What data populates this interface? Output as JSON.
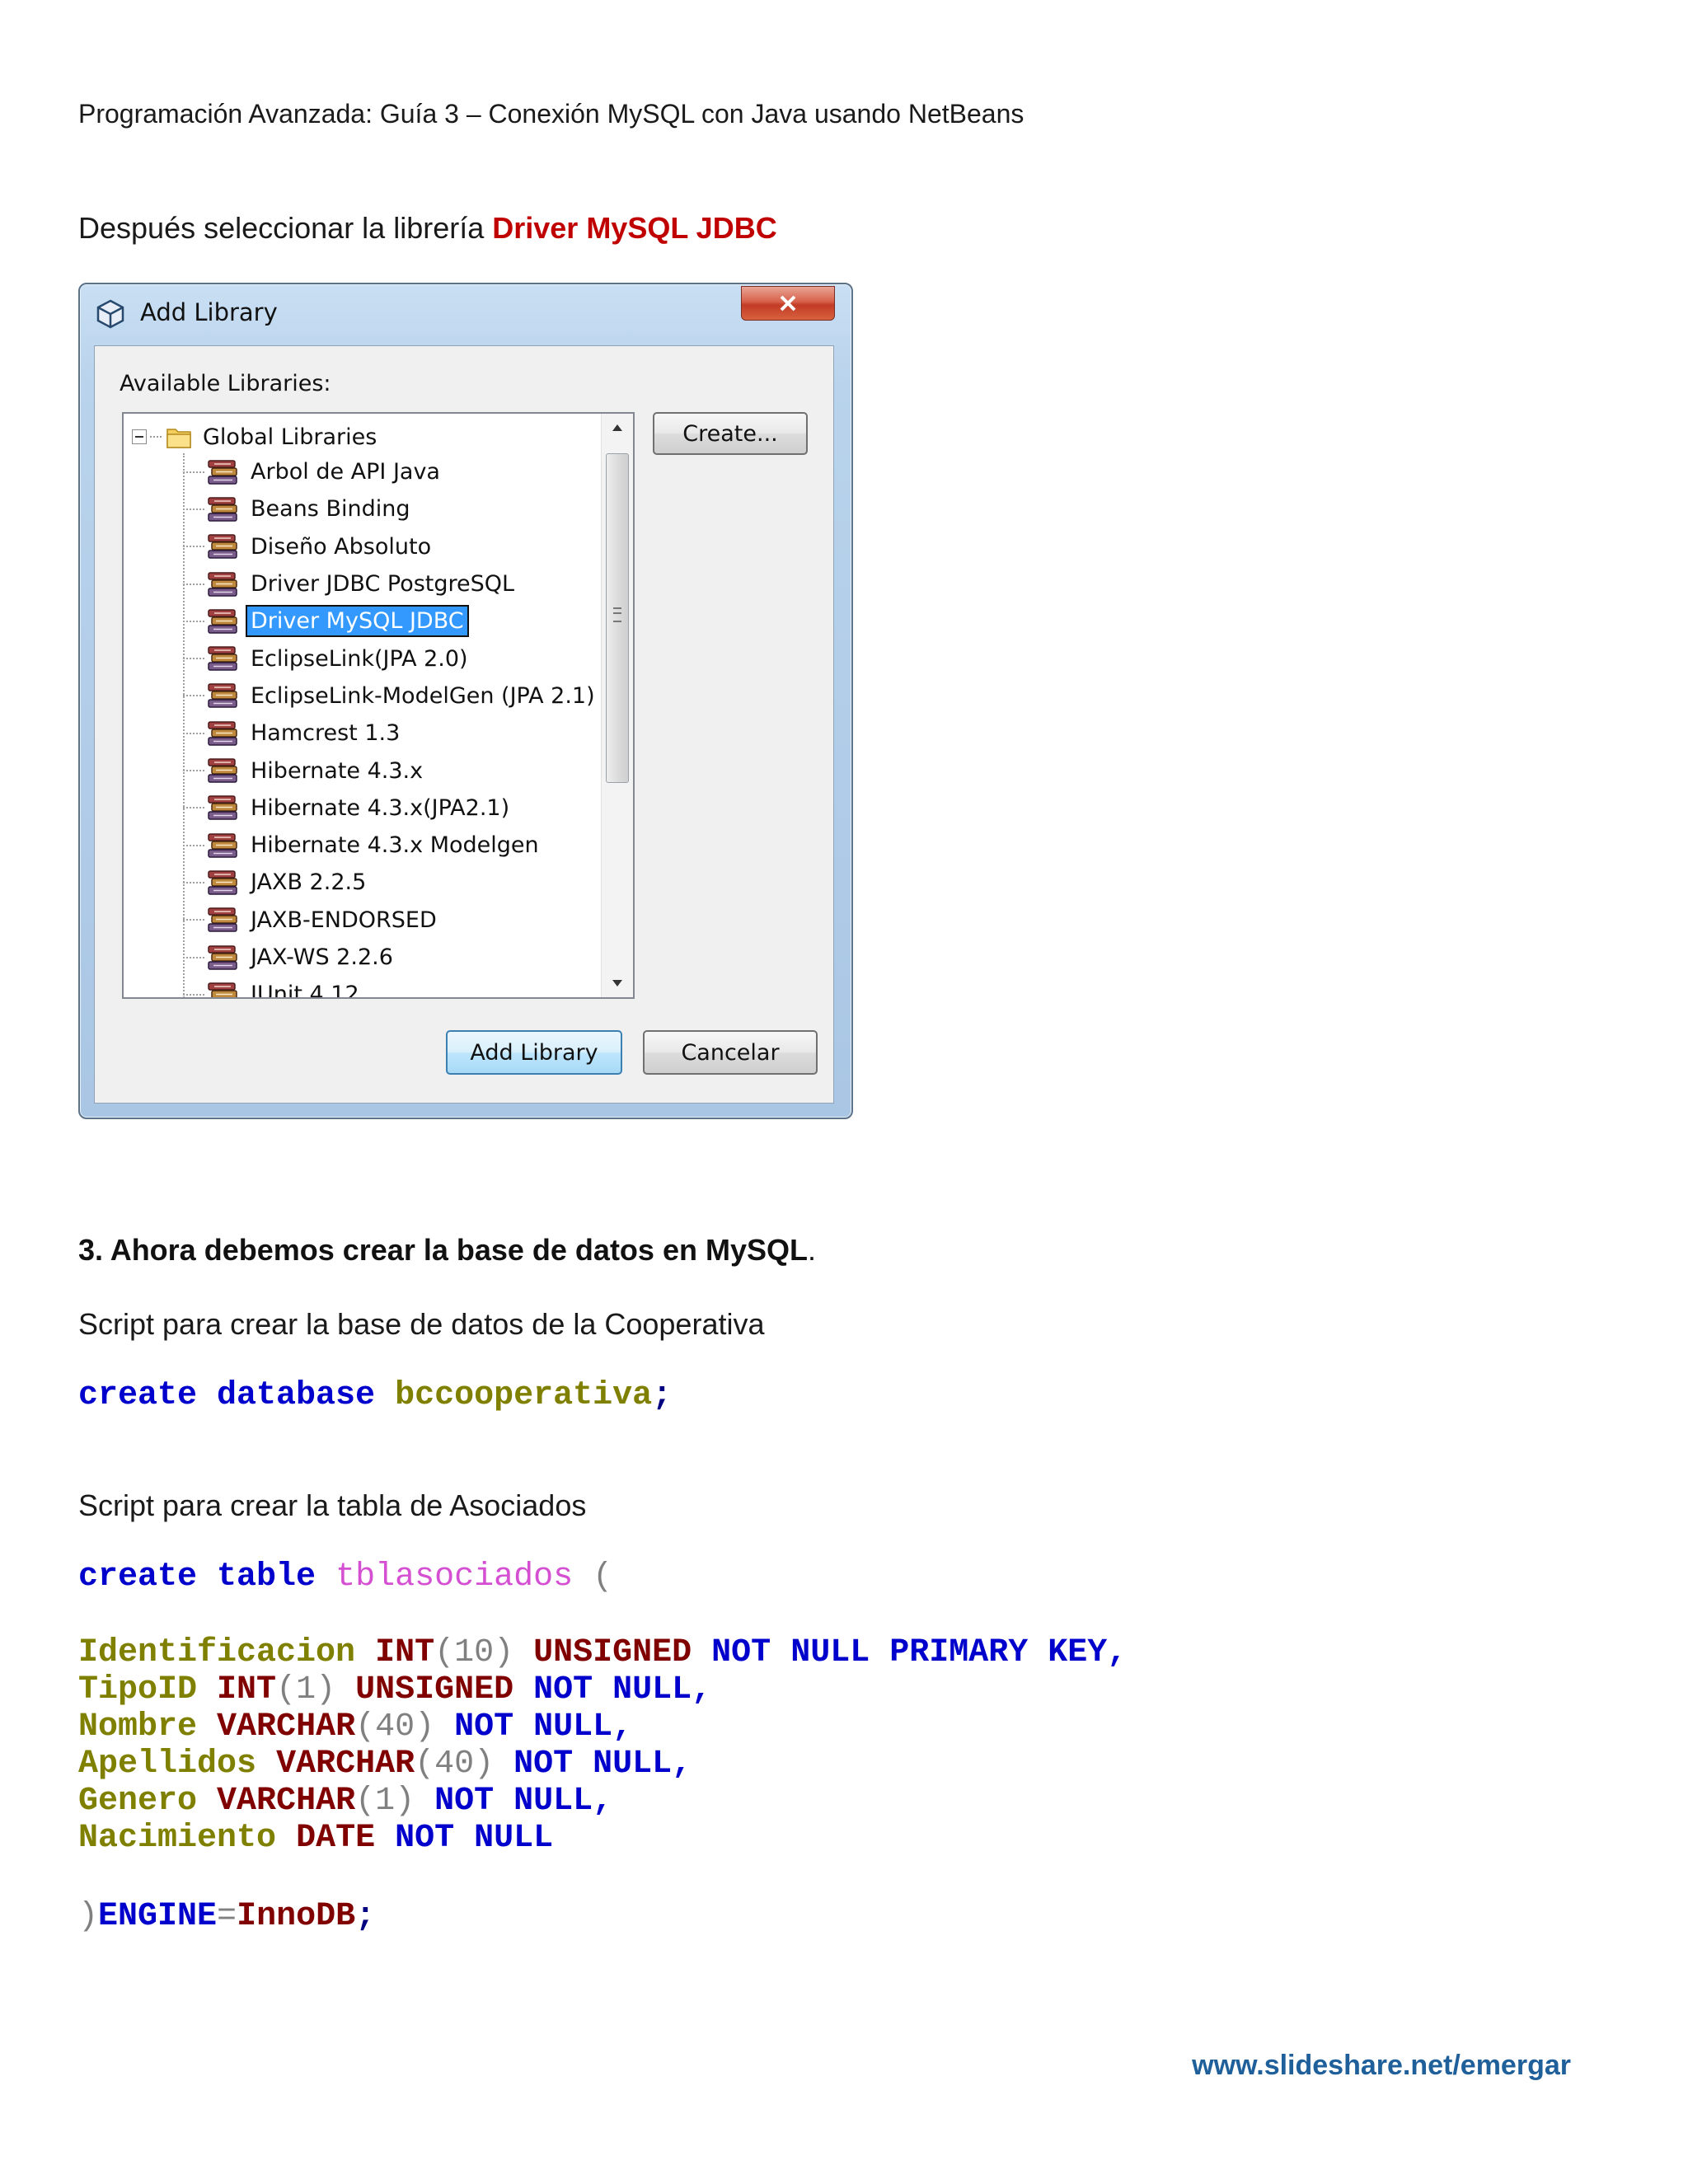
{
  "header": {
    "text": "Programación Avanzada: Guía 3 – Conexión MySQL con Java usando NetBeans"
  },
  "intro": {
    "prefix": "Después seleccionar la librería ",
    "highlight": "Driver MySQL JDBC"
  },
  "dialog": {
    "title": "Add Library",
    "available_label": "Available Libraries:",
    "tree_root": "Global Libraries",
    "libraries": [
      "Arbol de API Java",
      "Beans Binding",
      "Diseño Absoluto",
      "Driver JDBC PostgreSQL",
      "Driver MySQL JDBC",
      "EclipseLink(JPA 2.0)",
      "EclipseLink-ModelGen (JPA 2.1)",
      "Hamcrest 1.3",
      "Hibernate 4.3.x",
      "Hibernate 4.3.x(JPA2.1)",
      "Hibernate 4.3.x Modelgen",
      "JAXB 2.2.5",
      "JAXB-ENDORSED",
      "JAX-WS 2.2.6",
      "JUnit 4.12"
    ],
    "selected_library": "Driver MySQL JDBC",
    "buttons": {
      "create": "Create...",
      "add_library": "Add Library",
      "cancel": "Cancelar"
    }
  },
  "section3": {
    "heading": "3. Ahora debemos crear la base de datos en MySQL",
    "heading_period": ".",
    "db_script_label": "Script para crear la base de datos de la Cooperativa",
    "create_db": {
      "kw": "create database",
      "name": "bccooperativa",
      "semicolon": ";"
    },
    "table_script_label": "Script para crear la tabla de Asociados",
    "create_table": {
      "kw": "create table",
      "name": "tblasociados",
      "open_paren": "("
    },
    "columns": [
      {
        "name": "Identificacion",
        "type": "INT",
        "size": "(10)",
        "constraints": "UNSIGNED",
        "tail": "NOT NULL PRIMARY KEY,"
      },
      {
        "name": "TipoID",
        "type": "INT",
        "size": "(1)",
        "constraints": "UNSIGNED",
        "tail": "NOT NULL,"
      },
      {
        "name": "Nombre",
        "type": "VARCHAR",
        "size": "(40)",
        "constraints": "",
        "tail": "NOT NULL,"
      },
      {
        "name": "Apellidos",
        "type": "VARCHAR",
        "size": "(40)",
        "constraints": "",
        "tail": "NOT NULL,"
      },
      {
        "name": "Genero",
        "type": "VARCHAR",
        "size": "(1)",
        "constraints": "",
        "tail": "NOT NULL,"
      },
      {
        "name": "Nacimiento",
        "type": "DATE",
        "size": "",
        "constraints": "",
        "tail": "NOT NULL"
      }
    ],
    "closing": {
      "paren": ")",
      "engine_kw": "ENGINE",
      "equals": "=",
      "engine_value": "InnoDB",
      "semicolon": ";"
    }
  },
  "footer": {
    "link": "www.slideshare.net/emergar"
  },
  "colors": {
    "highlight_red": "#c00000",
    "keyword_blue": "#0000cc",
    "type_maroon": "#800000",
    "identifier_olive": "#808000",
    "table_name_pink": "#d44fd1",
    "selection_blue": "#3399ff",
    "footer_link": "#1f5f9a"
  }
}
